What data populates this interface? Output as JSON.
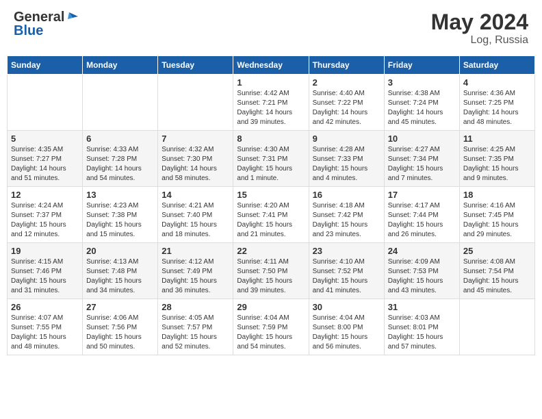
{
  "header": {
    "logo_general": "General",
    "logo_blue": "Blue",
    "month_year": "May 2024",
    "location": "Log, Russia"
  },
  "weekdays": [
    "Sunday",
    "Monday",
    "Tuesday",
    "Wednesday",
    "Thursday",
    "Friday",
    "Saturday"
  ],
  "weeks": [
    [
      {
        "day": "",
        "info": ""
      },
      {
        "day": "",
        "info": ""
      },
      {
        "day": "",
        "info": ""
      },
      {
        "day": "1",
        "info": "Sunrise: 4:42 AM\nSunset: 7:21 PM\nDaylight: 14 hours\nand 39 minutes."
      },
      {
        "day": "2",
        "info": "Sunrise: 4:40 AM\nSunset: 7:22 PM\nDaylight: 14 hours\nand 42 minutes."
      },
      {
        "day": "3",
        "info": "Sunrise: 4:38 AM\nSunset: 7:24 PM\nDaylight: 14 hours\nand 45 minutes."
      },
      {
        "day": "4",
        "info": "Sunrise: 4:36 AM\nSunset: 7:25 PM\nDaylight: 14 hours\nand 48 minutes."
      }
    ],
    [
      {
        "day": "5",
        "info": "Sunrise: 4:35 AM\nSunset: 7:27 PM\nDaylight: 14 hours\nand 51 minutes."
      },
      {
        "day": "6",
        "info": "Sunrise: 4:33 AM\nSunset: 7:28 PM\nDaylight: 14 hours\nand 54 minutes."
      },
      {
        "day": "7",
        "info": "Sunrise: 4:32 AM\nSunset: 7:30 PM\nDaylight: 14 hours\nand 58 minutes."
      },
      {
        "day": "8",
        "info": "Sunrise: 4:30 AM\nSunset: 7:31 PM\nDaylight: 15 hours\nand 1 minute."
      },
      {
        "day": "9",
        "info": "Sunrise: 4:28 AM\nSunset: 7:33 PM\nDaylight: 15 hours\nand 4 minutes."
      },
      {
        "day": "10",
        "info": "Sunrise: 4:27 AM\nSunset: 7:34 PM\nDaylight: 15 hours\nand 7 minutes."
      },
      {
        "day": "11",
        "info": "Sunrise: 4:25 AM\nSunset: 7:35 PM\nDaylight: 15 hours\nand 9 minutes."
      }
    ],
    [
      {
        "day": "12",
        "info": "Sunrise: 4:24 AM\nSunset: 7:37 PM\nDaylight: 15 hours\nand 12 minutes."
      },
      {
        "day": "13",
        "info": "Sunrise: 4:23 AM\nSunset: 7:38 PM\nDaylight: 15 hours\nand 15 minutes."
      },
      {
        "day": "14",
        "info": "Sunrise: 4:21 AM\nSunset: 7:40 PM\nDaylight: 15 hours\nand 18 minutes."
      },
      {
        "day": "15",
        "info": "Sunrise: 4:20 AM\nSunset: 7:41 PM\nDaylight: 15 hours\nand 21 minutes."
      },
      {
        "day": "16",
        "info": "Sunrise: 4:18 AM\nSunset: 7:42 PM\nDaylight: 15 hours\nand 23 minutes."
      },
      {
        "day": "17",
        "info": "Sunrise: 4:17 AM\nSunset: 7:44 PM\nDaylight: 15 hours\nand 26 minutes."
      },
      {
        "day": "18",
        "info": "Sunrise: 4:16 AM\nSunset: 7:45 PM\nDaylight: 15 hours\nand 29 minutes."
      }
    ],
    [
      {
        "day": "19",
        "info": "Sunrise: 4:15 AM\nSunset: 7:46 PM\nDaylight: 15 hours\nand 31 minutes."
      },
      {
        "day": "20",
        "info": "Sunrise: 4:13 AM\nSunset: 7:48 PM\nDaylight: 15 hours\nand 34 minutes."
      },
      {
        "day": "21",
        "info": "Sunrise: 4:12 AM\nSunset: 7:49 PM\nDaylight: 15 hours\nand 36 minutes."
      },
      {
        "day": "22",
        "info": "Sunrise: 4:11 AM\nSunset: 7:50 PM\nDaylight: 15 hours\nand 39 minutes."
      },
      {
        "day": "23",
        "info": "Sunrise: 4:10 AM\nSunset: 7:52 PM\nDaylight: 15 hours\nand 41 minutes."
      },
      {
        "day": "24",
        "info": "Sunrise: 4:09 AM\nSunset: 7:53 PM\nDaylight: 15 hours\nand 43 minutes."
      },
      {
        "day": "25",
        "info": "Sunrise: 4:08 AM\nSunset: 7:54 PM\nDaylight: 15 hours\nand 45 minutes."
      }
    ],
    [
      {
        "day": "26",
        "info": "Sunrise: 4:07 AM\nSunset: 7:55 PM\nDaylight: 15 hours\nand 48 minutes."
      },
      {
        "day": "27",
        "info": "Sunrise: 4:06 AM\nSunset: 7:56 PM\nDaylight: 15 hours\nand 50 minutes."
      },
      {
        "day": "28",
        "info": "Sunrise: 4:05 AM\nSunset: 7:57 PM\nDaylight: 15 hours\nand 52 minutes."
      },
      {
        "day": "29",
        "info": "Sunrise: 4:04 AM\nSunset: 7:59 PM\nDaylight: 15 hours\nand 54 minutes."
      },
      {
        "day": "30",
        "info": "Sunrise: 4:04 AM\nSunset: 8:00 PM\nDaylight: 15 hours\nand 56 minutes."
      },
      {
        "day": "31",
        "info": "Sunrise: 4:03 AM\nSunset: 8:01 PM\nDaylight: 15 hours\nand 57 minutes."
      },
      {
        "day": "",
        "info": ""
      }
    ]
  ]
}
